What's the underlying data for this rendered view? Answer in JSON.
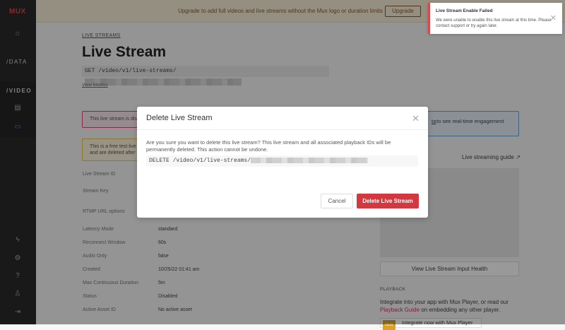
{
  "sidebar": {
    "logo": "MUX",
    "data_label": "/DATA",
    "video_label": "/VIDEO"
  },
  "banner": {
    "text": "Upgrade to add full videos and live streams without the Mux logo or duration limits",
    "upgrade_label": "Upgrade"
  },
  "page": {
    "breadcrumb": "LIVE STREAMS",
    "title": "Live Stream",
    "get_request": "GET /video/v1/live-streams/",
    "view_metrics": "View Metrics",
    "alert_disabled": "This live stream is dis",
    "alert_free_1": "This is a free test live",
    "alert_free_2": "and are deleted after",
    "alert_data_link": "ta",
    "alert_data_text": "to see real-time engagement",
    "guide_link": "Live streaming guide",
    "details": [
      {
        "label": "Live Stream ID",
        "value": ""
      },
      {
        "label": "Stream Key",
        "value": ""
      },
      {
        "label": "RTMP URL options",
        "value": ""
      },
      {
        "label": "Latency Mode",
        "value": "standard"
      },
      {
        "label": "Reconnect Window",
        "value": "60s"
      },
      {
        "label": "Audio Only",
        "value": "false"
      },
      {
        "label": "Created",
        "value": "10/25/22 01:41 am"
      },
      {
        "label": "Max Continuous Duration",
        "value": "5m"
      },
      {
        "label": "Status",
        "value": "Disabled"
      },
      {
        "label": "Active Asset ID",
        "value": "No active asset"
      }
    ],
    "health_button": "View Live Stream Input Health",
    "playback_heading": "PLAYBACK",
    "playback_text_1": "Integrate into your app with Mux Player, or read our",
    "playback_link": "Playback Guide",
    "playback_text_2": "on embedding any other player.",
    "new_badge": "NEW",
    "integrate_label": "Integrate now with Mux Player"
  },
  "modal": {
    "title": "Delete Live Stream",
    "body": "Are you sure you want to delete this live stream? This live stream and all associated playback IDs will be permanently deleted. This action cannot be undone.",
    "code": "DELETE /video/v1/live-streams/",
    "cancel_label": "Cancel",
    "delete_label": "Delete Live Stream"
  },
  "toast": {
    "title": "Live Stream Enable Failed",
    "message": "We were unable to enable this live stream at this time. Please contact support or try again later."
  },
  "colors": {
    "accent": "#d2383f",
    "toast_border": "#e0464c",
    "link": "#d0336f"
  }
}
